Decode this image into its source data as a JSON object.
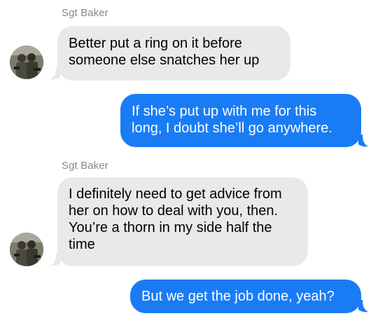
{
  "thread": {
    "messages": [
      {
        "type": "sender",
        "text": "Sgt Baker"
      },
      {
        "type": "incoming",
        "text": "Better put a ring on it before someone else snatches her up"
      },
      {
        "type": "outgoing",
        "text": "If she’s put up with me for this long, I doubt she’ll go anywhere."
      },
      {
        "type": "sender",
        "text": "Sgt Baker"
      },
      {
        "type": "incoming",
        "text": "I definitely need to get advice from her on how to deal with you, then. You’re a thorn in my side half the time"
      },
      {
        "type": "outgoing",
        "text": "But we get the job done, yeah?"
      }
    ]
  },
  "colors": {
    "incoming_bubble": "#e9e9eb",
    "outgoing_bubble": "#1a7cf5",
    "sender_label": "#8a8a8e"
  },
  "avatar": {
    "icon": "contact-photo-icon"
  }
}
